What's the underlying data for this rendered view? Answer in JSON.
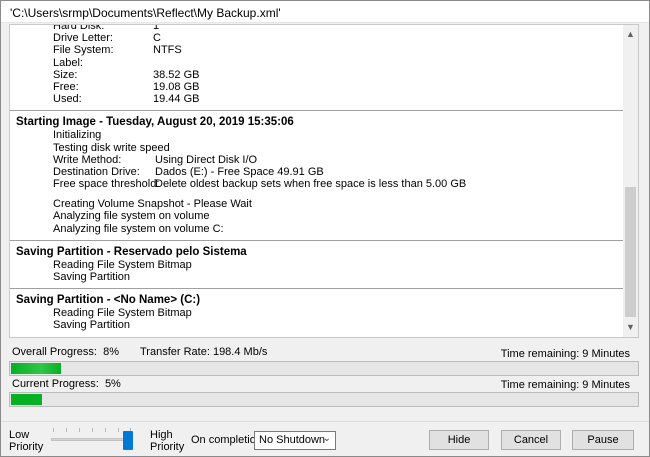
{
  "window": {
    "title": "'C:\\Users\\srmp\\Documents\\Reflect\\My Backup.xml'"
  },
  "log": {
    "disk_info": [
      {
        "key": "Hard Disk:",
        "value": "1"
      },
      {
        "key": "Drive Letter:",
        "value": "C"
      },
      {
        "key": "File System:",
        "value": "NTFS"
      },
      {
        "key": "Label:",
        "value": ""
      },
      {
        "key": "Size:",
        "value": "38.52 GB"
      },
      {
        "key": "Free:",
        "value": "19.08 GB"
      },
      {
        "key": "Used:",
        "value": "19.44 GB"
      }
    ],
    "imaging": {
      "title": "Starting Image - Tuesday, August 20, 2019 15:35:06",
      "lines_before": [
        "Initializing",
        "Testing disk write speed"
      ],
      "details": [
        {
          "key": "Write Method:",
          "value": "Using Direct Disk I/O"
        },
        {
          "key": "Destination Drive:",
          "value": "Dados (E:) - Free Space 49.91 GB"
        },
        {
          "key": "Free space threshold:",
          "value": "Delete oldest backup sets when free space is less than 5.00 GB"
        }
      ],
      "lines_after": [
        "Creating Volume Snapshot - Please Wait",
        "Analyzing file system on volume",
        "Analyzing file system on volume C:"
      ]
    },
    "partition1": {
      "title": "Saving Partition - Reservado pelo Sistema",
      "lines": [
        "Reading File System Bitmap",
        "Saving Partition"
      ]
    },
    "partition2": {
      "title": "Saving Partition - <No Name> (C:)",
      "lines": [
        "Reading File System Bitmap",
        "Saving Partition"
      ]
    }
  },
  "progress": {
    "overall_label": "Overall Progress:",
    "overall_percent_text": "8%",
    "overall_percent": 8,
    "transfer_rate_text": "Transfer Rate: 198.4 Mb/s",
    "overall_time_remaining": "Time remaining: 9 Minutes",
    "current_label": "Current Progress:",
    "current_percent_text": "5%",
    "current_percent": 5,
    "current_time_remaining": "Time remaining: 9 Minutes"
  },
  "controls": {
    "low_priority": "Low Priority",
    "high_priority": "High Priority",
    "on_completion_label": "On completion",
    "on_completion_value": "No Shutdown",
    "priority_level": 1.0,
    "hide_label": "Hide",
    "cancel_label": "Cancel",
    "pause_label": "Pause"
  },
  "colors": {
    "progress_fill": "#06b025",
    "slider_accent": "#0078d7"
  },
  "icons": {
    "scroll_up": "chevron-up-icon",
    "scroll_down": "chevron-down-icon",
    "dropdown": "chevron-down-icon"
  }
}
